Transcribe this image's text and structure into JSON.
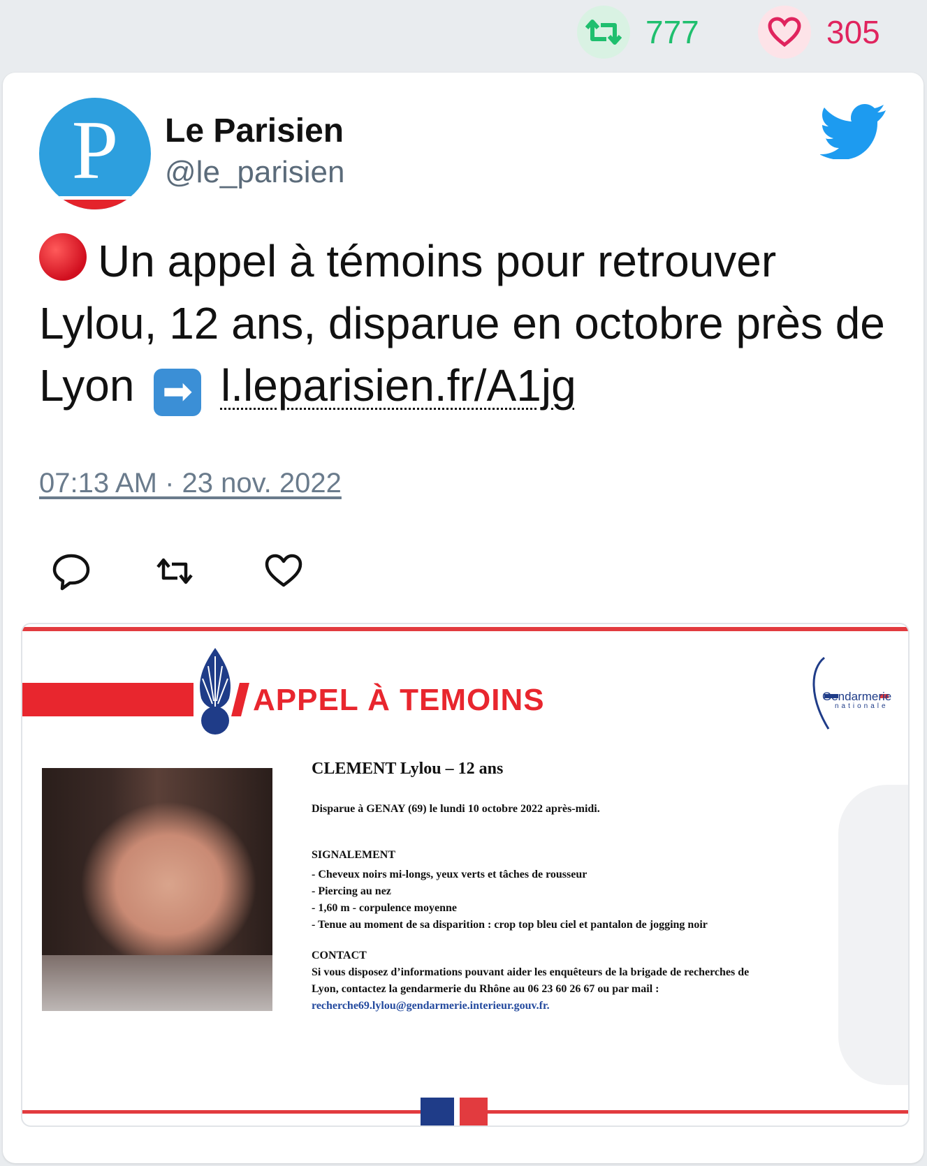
{
  "stats": {
    "retweets": "777",
    "likes": "305",
    "colors": {
      "retweet": "#1fbf6e",
      "like": "#e0245e"
    }
  },
  "author": {
    "name": "Le Parisien",
    "handle": "@le_parisien",
    "avatar_letter": "P"
  },
  "tweet": {
    "text": "Un appel à témoins pour retrouver Lylou, 12 ans, disparue en octobre près de Lyon",
    "link": "l.leparisien.fr/A1jg",
    "emoji_start": "red-circle",
    "emoji_arrow": "right-arrow",
    "timestamp": "07:13 AM · 23 nov. 2022"
  },
  "actions": {
    "reply": "reply-icon",
    "retweet": "retweet-icon",
    "like": "heart-icon"
  },
  "poster": {
    "heading": "APPEL À TEMOINS",
    "org_logo": "Gendarmerie",
    "org_logo_sub": "nationale",
    "person": "CLEMENT Lylou – 12 ans",
    "disappeared": "Disparue à GENAY (69) le lundi 10 octobre 2022 après-midi.",
    "description_title": "SIGNALEMENT",
    "description": [
      "- Cheveux noirs mi-longs, yeux verts et tâches de rousseur",
      "- Piercing au nez",
      "- 1,60 m - corpulence moyenne",
      "- Tenue au moment de sa disparition : crop top bleu ciel et pantalon de jogging noir"
    ],
    "contact_title": "CONTACT",
    "contact_lines": [
      "Si vous disposez d’informations pouvant aider les enquêteurs de la brigade de recherches de",
      "Lyon, contactez la gendarmerie du Rhône au 06 23 60 26 67 ou par mail :"
    ],
    "contact_email": "recherche69.lylou@gendarmerie.interieur.gouv.fr."
  }
}
